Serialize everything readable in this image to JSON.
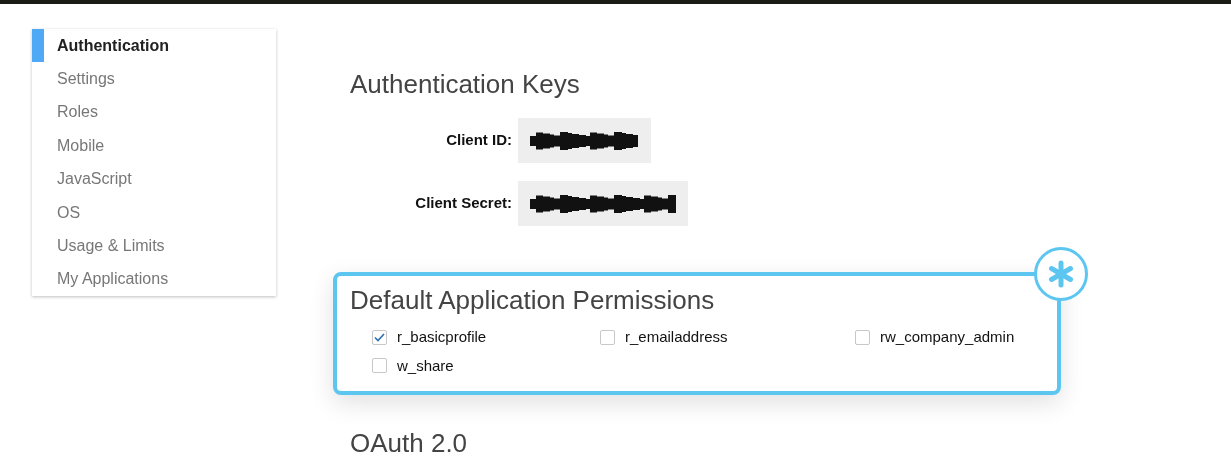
{
  "sidebar": {
    "items": [
      {
        "label": "Authentication",
        "selected": true
      },
      {
        "label": "Settings",
        "selected": false
      },
      {
        "label": "Roles",
        "selected": false
      },
      {
        "label": "Mobile",
        "selected": false
      },
      {
        "label": "JavaScript",
        "selected": false
      },
      {
        "label": "OS",
        "selected": false
      },
      {
        "label": "Usage & Limits",
        "selected": false
      },
      {
        "label": "My Applications",
        "selected": false
      }
    ]
  },
  "auth_keys": {
    "title": "Authentication Keys",
    "fields": [
      {
        "label": "Client ID:"
      },
      {
        "label": "Client Secret:"
      }
    ]
  },
  "permissions": {
    "title": "Default Application Permissions",
    "items": [
      {
        "label": "r_basicprofile",
        "checked": true
      },
      {
        "label": "r_emailaddress",
        "checked": false
      },
      {
        "label": "rw_company_admin",
        "checked": false
      },
      {
        "label": "w_share",
        "checked": false
      }
    ]
  },
  "oauth": {
    "title": "OAuth 2.0"
  }
}
